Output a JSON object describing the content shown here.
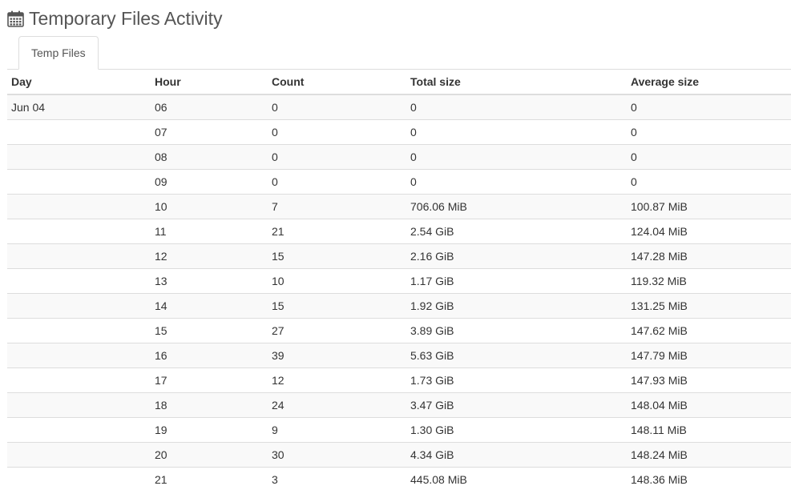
{
  "header": {
    "title": "Temporary Files Activity",
    "icon": "calendar-icon"
  },
  "tabs": [
    {
      "label": "Temp Files",
      "active": true
    }
  ],
  "table": {
    "columns": [
      "Day",
      "Hour",
      "Count",
      "Total size",
      "Average size"
    ],
    "rows": [
      {
        "day": "Jun 04",
        "hour": "06",
        "count": "0",
        "total_size": "0",
        "average_size": "0"
      },
      {
        "day": "",
        "hour": "07",
        "count": "0",
        "total_size": "0",
        "average_size": "0"
      },
      {
        "day": "",
        "hour": "08",
        "count": "0",
        "total_size": "0",
        "average_size": "0"
      },
      {
        "day": "",
        "hour": "09",
        "count": "0",
        "total_size": "0",
        "average_size": "0"
      },
      {
        "day": "",
        "hour": "10",
        "count": "7",
        "total_size": "706.06 MiB",
        "average_size": "100.87 MiB"
      },
      {
        "day": "",
        "hour": "11",
        "count": "21",
        "total_size": "2.54 GiB",
        "average_size": "124.04 MiB"
      },
      {
        "day": "",
        "hour": "12",
        "count": "15",
        "total_size": "2.16 GiB",
        "average_size": "147.28 MiB"
      },
      {
        "day": "",
        "hour": "13",
        "count": "10",
        "total_size": "1.17 GiB",
        "average_size": "119.32 MiB"
      },
      {
        "day": "",
        "hour": "14",
        "count": "15",
        "total_size": "1.92 GiB",
        "average_size": "131.25 MiB"
      },
      {
        "day": "",
        "hour": "15",
        "count": "27",
        "total_size": "3.89 GiB",
        "average_size": "147.62 MiB"
      },
      {
        "day": "",
        "hour": "16",
        "count": "39",
        "total_size": "5.63 GiB",
        "average_size": "147.79 MiB"
      },
      {
        "day": "",
        "hour": "17",
        "count": "12",
        "total_size": "1.73 GiB",
        "average_size": "147.93 MiB"
      },
      {
        "day": "",
        "hour": "18",
        "count": "24",
        "total_size": "3.47 GiB",
        "average_size": "148.04 MiB"
      },
      {
        "day": "",
        "hour": "19",
        "count": "9",
        "total_size": "1.30 GiB",
        "average_size": "148.11 MiB"
      },
      {
        "day": "",
        "hour": "20",
        "count": "30",
        "total_size": "4.34 GiB",
        "average_size": "148.24 MiB"
      },
      {
        "day": "",
        "hour": "21",
        "count": "3",
        "total_size": "445.08 MiB",
        "average_size": "148.36 MiB"
      }
    ]
  },
  "colors": {
    "title": "#555555",
    "text": "#333333",
    "border": "#dddddd",
    "stripe": "#f9f9f9"
  }
}
